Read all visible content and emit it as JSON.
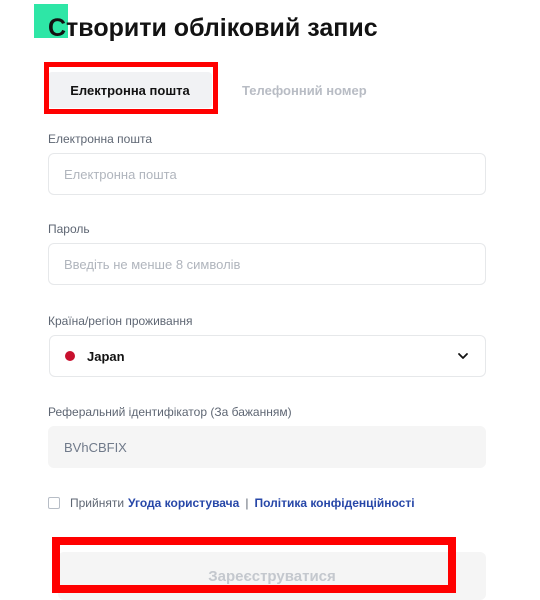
{
  "page": {
    "title": "Створити обліковий запис"
  },
  "tabs": [
    {
      "label": "Електронна пошта",
      "active": true
    },
    {
      "label": "Телефонний номер",
      "active": false
    }
  ],
  "form": {
    "email": {
      "label": "Електронна пошта",
      "placeholder": "Електронна пошта",
      "value": ""
    },
    "password": {
      "label": "Пароль",
      "placeholder": "Введіть не менше 8 символів",
      "value": ""
    },
    "country": {
      "label": "Країна/регіон проживання",
      "value": "Japan"
    },
    "referral": {
      "label": "Реферальний ідентифікатор (За бажанням)",
      "value": "BVhCBFIX"
    }
  },
  "agreement": {
    "text": "Прийняти",
    "terms_link": "Угода користувача",
    "separator": "|",
    "privacy_link": "Політика конфіденційності",
    "checked": false
  },
  "register_button": {
    "label": "Зареєструватися",
    "enabled": false
  },
  "colors": {
    "accent": "#2ee6a6",
    "highlight": "#ff0000",
    "link": "#2747a8",
    "flag_red": "#c8102e"
  },
  "icons": [
    "japan-flag-icon",
    "chevron-down-icon",
    "checkbox-icon"
  ]
}
